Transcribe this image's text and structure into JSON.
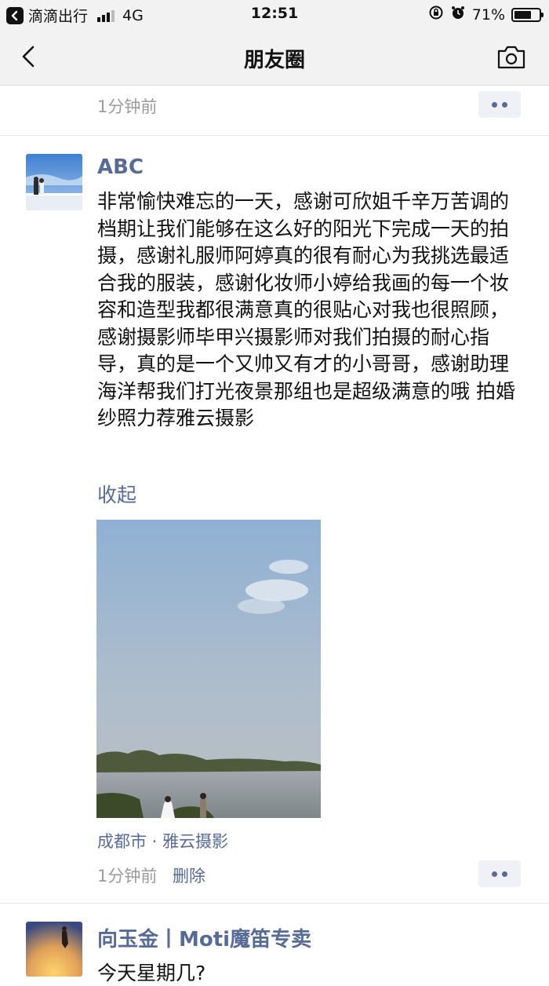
{
  "status_bar": {
    "back_app": "滴滴出行",
    "network": "4G",
    "time": "12:51",
    "battery": "71%",
    "battery_level": 0.71
  },
  "nav": {
    "title": "朋友圈"
  },
  "prev_post": {
    "time": "1分钟前"
  },
  "post": {
    "author": "ABC",
    "text": "非常愉快难忘的一天，感谢可欣姐千辛万苦调的档期让我们能够在这么好的阳光下完成一天的拍摄，感谢礼服师阿婷真的很有耐心为我挑选最适合我的服装，感谢化妆师小婷给我画的每一个妆容和造型我都很满意真的很贴心对我也很照顾，感谢摄影师毕甲兴摄影师对我们拍摄的耐心指导，真的是一个又帅又有才的小哥哥，感谢助理海洋帮我们打光夜景那组也是超级满意的哦 拍婚纱照力荐雅云摄影",
    "collapse": "收起",
    "location": "成都市 · 雅云摄影",
    "time": "1分钟前",
    "delete": "删除"
  },
  "next_post": {
    "author": "向玉金丨Moti魔笛专卖",
    "text": "今天星期几?"
  },
  "colors": {
    "link": "#576b95",
    "bar_bg": "#f2f2f2",
    "time_gray": "#9b9b9b"
  }
}
